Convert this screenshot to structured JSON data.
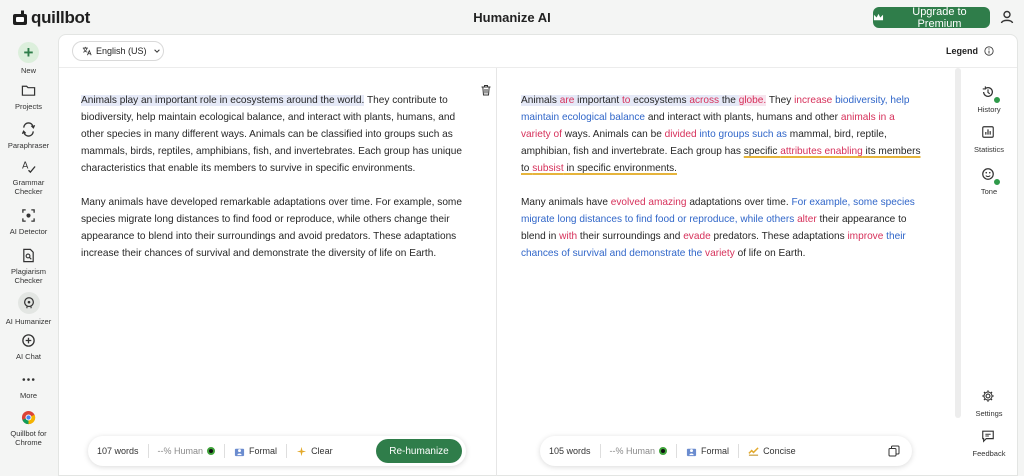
{
  "app": {
    "logo_text": "quillbot",
    "title": "Humanize AI"
  },
  "header": {
    "upgrade_label": "Upgrade to Premium"
  },
  "sidebar": {
    "items": [
      {
        "label": "New",
        "icon": "plus-icon"
      },
      {
        "label": "Projects",
        "icon": "folder-icon"
      },
      {
        "label": "Paraphraser",
        "icon": "paraphraser-icon"
      },
      {
        "label": "Grammar Checker",
        "icon": "grammar-icon"
      },
      {
        "label": "AI Detector",
        "icon": "ai-detector-icon"
      },
      {
        "label": "Plagiarism Checker",
        "icon": "plagiarism-icon"
      },
      {
        "label": "AI Humanizer",
        "icon": "ai-humanizer-icon"
      },
      {
        "label": "AI Chat",
        "icon": "ai-chat-icon"
      },
      {
        "label": "More",
        "icon": "more-icon"
      },
      {
        "label": "Quillbot for Chrome",
        "icon": "chrome-icon"
      }
    ]
  },
  "editor": {
    "language": "English (US)",
    "legend_label": "Legend",
    "input": {
      "p1_highlight": "Animals play an important role in ecosystems around the world.",
      "p1_rest": " They contribute to biodiversity, help maintain ecological balance, and interact with plants, humans, and other species in many different ways. Animals can be classified into groups such as mammals, birds, reptiles, amphibians, fish, and invertebrates. Each group has unique characteristics that enable its members to survive in specific environments.",
      "p2": "Many animals have developed remarkable adaptations over time. For example, some species migrate long distances to find food or reproduce, while others change their appearance to blend into their surroundings and avoid predators. These adaptations increase their chances of survival and demonstrate the diversity of life on Earth."
    },
    "output": {
      "p1": [
        {
          "t": "Animals",
          "c": "hl"
        },
        {
          "t": " ",
          "c": "hl"
        },
        {
          "t": "are",
          "c": "hl r"
        },
        {
          "t": " important ",
          "c": "hl"
        },
        {
          "t": "to",
          "c": "hl r"
        },
        {
          "t": " ecosystems ",
          "c": "hl"
        },
        {
          "t": "across",
          "c": "hl r"
        },
        {
          "t": " the ",
          "c": "hl"
        },
        {
          "t": "globe.",
          "c": "hl-pink r"
        },
        {
          "t": " They ",
          "c": ""
        },
        {
          "t": "increase",
          "c": "r"
        },
        {
          "t": " ",
          "c": ""
        },
        {
          "t": "biodiversity, help maintain ecological balance",
          "c": "b"
        },
        {
          "t": " and interact with plants, humans and other ",
          "c": ""
        },
        {
          "t": "animals",
          "c": "r"
        },
        {
          "t": " ",
          "c": ""
        },
        {
          "t": "in a variety of",
          "c": "r"
        },
        {
          "t": " ways. Animals can be ",
          "c": ""
        },
        {
          "t": "divided",
          "c": "r"
        },
        {
          "t": " ",
          "c": ""
        },
        {
          "t": "into groups such as",
          "c": "b"
        },
        {
          "t": " mammal, bird, reptile, amphibian, fish and invertebrate. Each group has ",
          "c": ""
        },
        {
          "t": "specific ",
          "c": "ul"
        },
        {
          "t": "attributes enabling",
          "c": "ul r"
        },
        {
          "t": " its members to ",
          "c": "ul"
        },
        {
          "t": "subsist",
          "c": "ul r"
        },
        {
          "t": " in specific environments.",
          "c": "ul"
        }
      ],
      "p2": [
        {
          "t": "Many animals have ",
          "c": ""
        },
        {
          "t": "evolved amazing",
          "c": "r"
        },
        {
          "t": " adaptations over time. ",
          "c": ""
        },
        {
          "t": "For example, some species migrate long distances to find food or reproduce, while others",
          "c": "b"
        },
        {
          "t": " ",
          "c": ""
        },
        {
          "t": "alter",
          "c": "r"
        },
        {
          "t": " their appearance to blend in ",
          "c": ""
        },
        {
          "t": "with",
          "c": "r"
        },
        {
          "t": " their surroundings and ",
          "c": ""
        },
        {
          "t": "evade",
          "c": "r"
        },
        {
          "t": " predators. These adaptations ",
          "c": ""
        },
        {
          "t": "improve",
          "c": "r"
        },
        {
          "t": " ",
          "c": ""
        },
        {
          "t": "their chances of survival and demonstrate the",
          "c": "b"
        },
        {
          "t": " ",
          "c": ""
        },
        {
          "t": "variety",
          "c": "r"
        },
        {
          "t": " of life on Earth.",
          "c": ""
        }
      ]
    },
    "left_toolbar": {
      "words": "107 words",
      "human": "--% Human",
      "mode": "Formal",
      "clear": "Clear",
      "button": "Re-humanize"
    },
    "right_toolbar": {
      "words": "105 words",
      "human": "--% Human",
      "mode": "Formal",
      "length": "Concise"
    }
  },
  "right_sidebar": {
    "history": "History",
    "statistics": "Statistics",
    "tone": "Tone",
    "settings": "Settings",
    "feedback": "Feedback"
  },
  "colors": {
    "brand": "#2f7d4a",
    "changed_word": "#d6305a",
    "structural_change": "#3066c9",
    "highlight": "#e5e9f7"
  }
}
